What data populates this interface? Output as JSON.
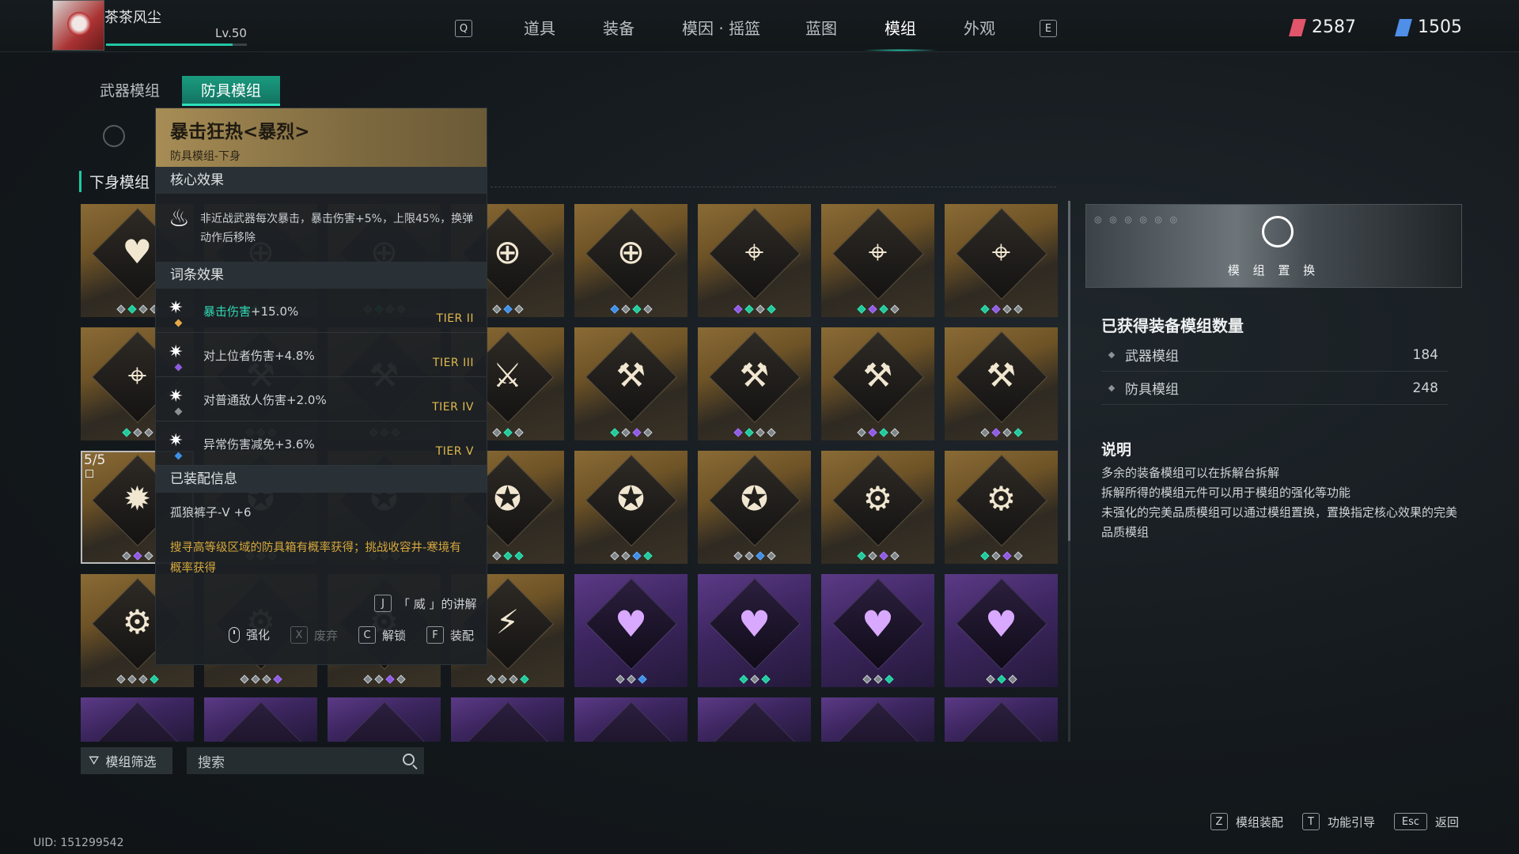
{
  "player": {
    "name": "茶茶风尘",
    "level": "Lv.50",
    "exp_fraction": 0.9
  },
  "nav": {
    "key_left": "Q",
    "key_right": "E",
    "items": [
      "道具",
      "装备",
      "模因 · 摇篮",
      "蓝图",
      "模组",
      "外观"
    ],
    "active": "模组"
  },
  "currency": [
    {
      "name": "red-gem",
      "value": "2587",
      "color": "#e0556a"
    },
    {
      "name": "blue-gem",
      "value": "1505",
      "color": "#4f8fe8"
    }
  ],
  "tabs": {
    "weapon": "武器模组",
    "armor": "防具模组",
    "active": "防具模组"
  },
  "section_title": "下身模组",
  "selected_card": {
    "count": "5/5"
  },
  "tooltip": {
    "title": "暴击狂热<暴烈>",
    "subtitle": "防具模组-下身",
    "core_header": "核心效果",
    "core_text": "非近战武器每次暴击，暴击伤害+5%，上限45%，换弹动作后移除",
    "affix_header": "词条效果",
    "affixes": [
      {
        "label": "暴击伤害",
        "value": "+15.0%",
        "tier": "TIER II",
        "highlight": true,
        "dot": "#e6a84a"
      },
      {
        "label": "对上位者伤害",
        "value": "+4.8%",
        "tier": "TIER III",
        "highlight": false,
        "dot": "#8f5be0"
      },
      {
        "label": "对普通敌人伤害",
        "value": "+2.0%",
        "tier": "TIER IV",
        "highlight": false,
        "dot": "#8a9094"
      },
      {
        "label": "异常伤害减免",
        "value": "+3.6%",
        "tier": "TIER V",
        "highlight": false,
        "dot": "#3f8fe5"
      }
    ],
    "equip_header": "已装配信息",
    "equip_text": "孤狼裤子-Ⅴ +6",
    "hint": "搜寻高等级区域的防具箱有概率获得；挑战收容井-寒境有概率获得",
    "lore": {
      "key": "J",
      "label": "「 威 」的讲解"
    },
    "actions": [
      {
        "key": "mouse",
        "label": "强化",
        "enabled": true
      },
      {
        "key": "X",
        "label": "废弃",
        "enabled": false
      },
      {
        "key": "C",
        "label": "解锁",
        "enabled": true
      },
      {
        "key": "F",
        "label": "装配",
        "enabled": true
      }
    ]
  },
  "filter": {
    "label": "模组筛选"
  },
  "search": {
    "placeholder": "搜索"
  },
  "uid": "UID: 151299542",
  "right_panel": {
    "banner_label": "模 组 置 换",
    "banner_deco": "◎ ◎ ◎ ◎ ◎ ◎",
    "count_title": "已获得装备模组数量",
    "rows": [
      {
        "label": "武器模组",
        "value": "184"
      },
      {
        "label": "防具模组",
        "value": "248"
      }
    ],
    "desc_title": "说明",
    "desc_lines": [
      "多余的装备模组可以在拆解台拆解",
      "拆解所得的模组元件可以用于模组的强化等功能",
      "未强化的完美品质模组可以通过模组置换，置换指定核心效果的完美品质模组"
    ]
  },
  "bottom_keys": [
    {
      "key": "Z",
      "label": "模组装配"
    },
    {
      "key": "T",
      "label": "功能引导"
    },
    {
      "key": "Esc",
      "label": "返回"
    }
  ],
  "cards": [
    {
      "quality": "gold",
      "icon": "heartbeat",
      "dots": [
        "n",
        "g",
        "n",
        "n"
      ]
    },
    {
      "quality": "gold",
      "icon": "target",
      "dots": [
        "n",
        "g",
        "n",
        "n"
      ]
    },
    {
      "quality": "gold",
      "icon": "target",
      "dots": [
        "n",
        "g",
        "n",
        "n"
      ]
    },
    {
      "quality": "gold",
      "icon": "target",
      "dots": [
        "n",
        "bl",
        "n"
      ]
    },
    {
      "quality": "gold",
      "icon": "target",
      "dots": [
        "bl",
        "n",
        "g",
        "n"
      ]
    },
    {
      "quality": "gold",
      "icon": "rifle-crosshair",
      "dots": [
        "p",
        "g",
        "n",
        "g"
      ]
    },
    {
      "quality": "gold",
      "icon": "rifle-crosshair",
      "dots": [
        "g",
        "p",
        "g",
        "n"
      ]
    },
    {
      "quality": "gold",
      "icon": "rifle-crosshair",
      "dots": [
        "g",
        "p",
        "n",
        "n"
      ]
    },
    {
      "quality": "gold",
      "icon": "rifle-crosshair",
      "dots": [
        "g",
        "n",
        "n"
      ]
    },
    {
      "quality": "gold",
      "icon": "hammer",
      "dots": [
        "n",
        "n",
        "n"
      ]
    },
    {
      "quality": "gold",
      "icon": "hammer",
      "dots": [
        "n",
        "n",
        "n"
      ]
    },
    {
      "quality": "gold",
      "icon": "blade-chevron",
      "dots": [
        "n",
        "g",
        "n"
      ]
    },
    {
      "quality": "gold",
      "icon": "hammer",
      "dots": [
        "g",
        "n",
        "p",
        "n"
      ]
    },
    {
      "quality": "gold",
      "icon": "hammer",
      "dots": [
        "p",
        "g",
        "n",
        "n"
      ]
    },
    {
      "quality": "gold",
      "icon": "hammer",
      "dots": [
        "n",
        "p",
        "g",
        "n"
      ]
    },
    {
      "quality": "gold",
      "icon": "hammer",
      "dots": [
        "n",
        "p",
        "n",
        "g"
      ]
    },
    {
      "quality": "gold",
      "icon": "crit-flame",
      "dots": [
        "n",
        "p",
        "n"
      ],
      "selected": true
    },
    {
      "quality": "gold",
      "icon": "star-boot",
      "dots": [
        "n",
        "n",
        "n"
      ]
    },
    {
      "quality": "gold",
      "icon": "star-boot",
      "dots": [
        "n",
        "n",
        "n"
      ]
    },
    {
      "quality": "gold",
      "icon": "star-boot",
      "dots": [
        "n",
        "g",
        "g"
      ]
    },
    {
      "quality": "gold",
      "icon": "star-boot",
      "dots": [
        "n",
        "n",
        "bl",
        "g"
      ]
    },
    {
      "quality": "gold",
      "icon": "star-boot",
      "dots": [
        "n",
        "n",
        "bl",
        "n"
      ]
    },
    {
      "quality": "gold",
      "icon": "gear-boot",
      "dots": [
        "g",
        "n",
        "p",
        "n"
      ]
    },
    {
      "quality": "gold",
      "icon": "gear-boot",
      "dots": [
        "g",
        "n",
        "p",
        "n"
      ]
    },
    {
      "quality": "gold",
      "icon": "gear-boot",
      "dots": [
        "n",
        "n",
        "n",
        "g"
      ]
    },
    {
      "quality": "gold",
      "icon": "gear-boot",
      "dots": [
        "n",
        "n",
        "n",
        "p"
      ]
    },
    {
      "quality": "gold",
      "icon": "gear-boot",
      "dots": [
        "n",
        "n",
        "p",
        "n"
      ]
    },
    {
      "quality": "gold",
      "icon": "ammo-blade",
      "dots": [
        "n",
        "n",
        "n",
        "g"
      ]
    },
    {
      "quality": "purple",
      "icon": "heartbeat",
      "dots": [
        "n",
        "n",
        "bl"
      ]
    },
    {
      "quality": "purple",
      "icon": "heartbeat",
      "dots": [
        "g",
        "n",
        "g"
      ]
    },
    {
      "quality": "purple",
      "icon": "heartbeat",
      "dots": [
        "n",
        "n",
        "g"
      ]
    },
    {
      "quality": "purple",
      "icon": "heartbeat",
      "dots": [
        "n",
        "g",
        "n"
      ]
    },
    {
      "quality": "purple",
      "icon": "partial",
      "dots": []
    },
    {
      "quality": "purple",
      "icon": "partial",
      "dots": []
    },
    {
      "quality": "purple",
      "icon": "partial",
      "dots": []
    },
    {
      "quality": "purple",
      "icon": "partial",
      "dots": []
    },
    {
      "quality": "purple",
      "icon": "partial",
      "dots": []
    },
    {
      "quality": "purple",
      "icon": "partial",
      "dots": []
    },
    {
      "quality": "purple",
      "icon": "partial",
      "dots": []
    },
    {
      "quality": "purple",
      "icon": "partial",
      "dots": []
    }
  ]
}
